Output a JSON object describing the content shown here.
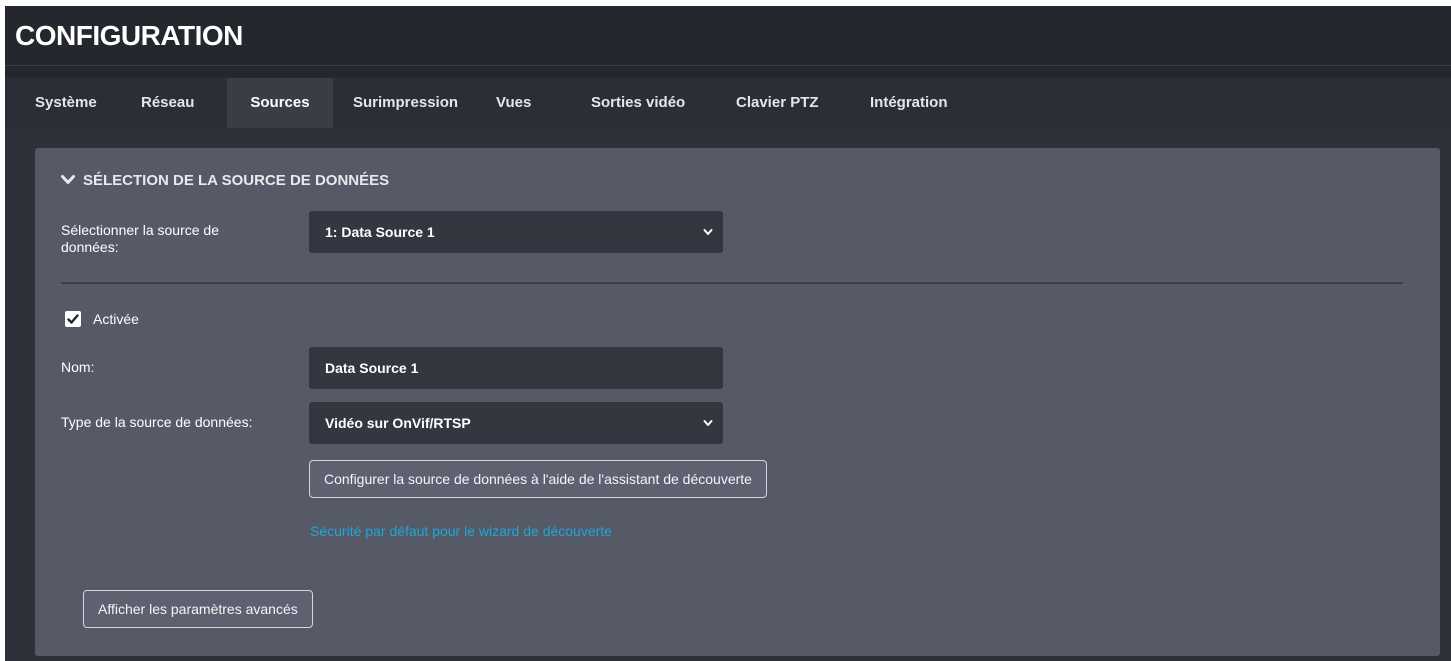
{
  "header": {
    "title": "CONFIGURATION"
  },
  "tabs": [
    {
      "label": "Système",
      "active": false
    },
    {
      "label": "Réseau",
      "active": false
    },
    {
      "label": "Sources",
      "active": true
    },
    {
      "label": "Surimpression",
      "active": false
    },
    {
      "label": "Vues",
      "active": false
    },
    {
      "label": "Sorties vidéo",
      "active": false
    },
    {
      "label": "Clavier PTZ",
      "active": false
    },
    {
      "label": "Intégration",
      "active": false
    }
  ],
  "section": {
    "title": "SÉLECTION DE LA SOURCE DE DONNÉES",
    "expanded": true,
    "icon": "chevron-down-icon"
  },
  "form": {
    "source_select": {
      "label_line1": "Sélectionner la source de",
      "label_line2": "données:",
      "value": "1: Data Source 1"
    },
    "enabled": {
      "label": "Activée",
      "checked": true
    },
    "name": {
      "label": "Nom:",
      "value": "Data Source 1"
    },
    "type": {
      "label": "Type de la source de données:",
      "value": "Vidéo sur OnVif/RTSP"
    },
    "discovery_button": "Configurer la source de données à l'aide de l'assistant de découverte",
    "security_link": "Sécurité par défaut pour le wizard de découverte",
    "advanced_button": "Afficher les paramètres avancés"
  },
  "colors": {
    "background": "#24272e",
    "tabbar": "#2b2e36",
    "panel": "#565a67",
    "field": "#34373f",
    "link": "#1fa6d8"
  }
}
